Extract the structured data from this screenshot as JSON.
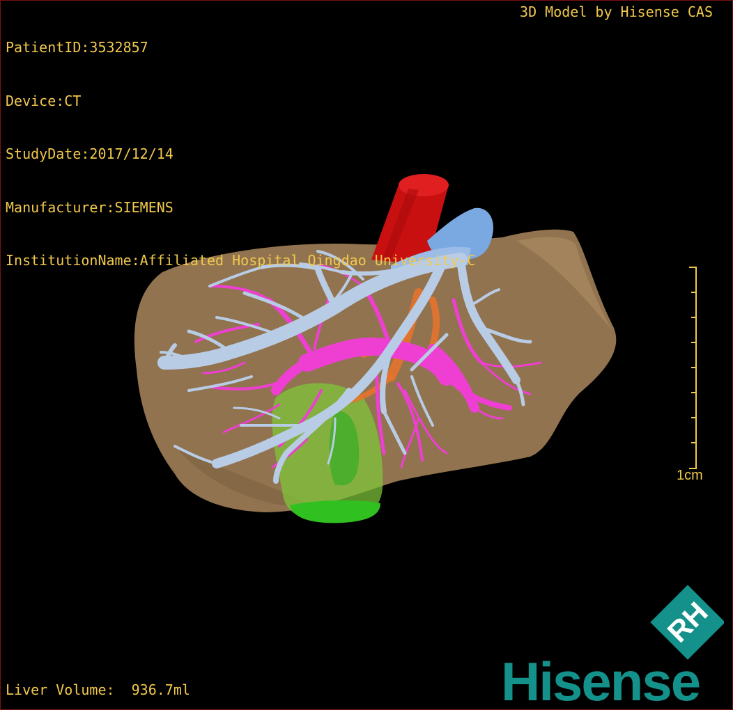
{
  "overlay": {
    "patient_id": "PatientID:3532857",
    "device": "Device:CT",
    "study_date": "StudyDate:2017/12/14",
    "manufacturer": "Manufacturer:SIEMENS",
    "institution": "InstitutionName:Affiliated Hospital Qingdao University-C",
    "credit": "3D Model by Hisense CAS",
    "liver_volume": "Liver Volume:  936.7ml",
    "scale_label": "1cm"
  },
  "brand": {
    "name": "Hisense",
    "logo_text": "RH",
    "color": "#14918a"
  },
  "colors": {
    "overlay_text": "#f2c94c",
    "liver": "#9c7c55",
    "portal_vein": "#b8cce6",
    "hepatic_artery": "#ee3fd2",
    "aorta": "#c81010",
    "ivc": "#7aa8e0",
    "gallbladder": "#5ed42a",
    "bile_duct": "#e9732a"
  }
}
